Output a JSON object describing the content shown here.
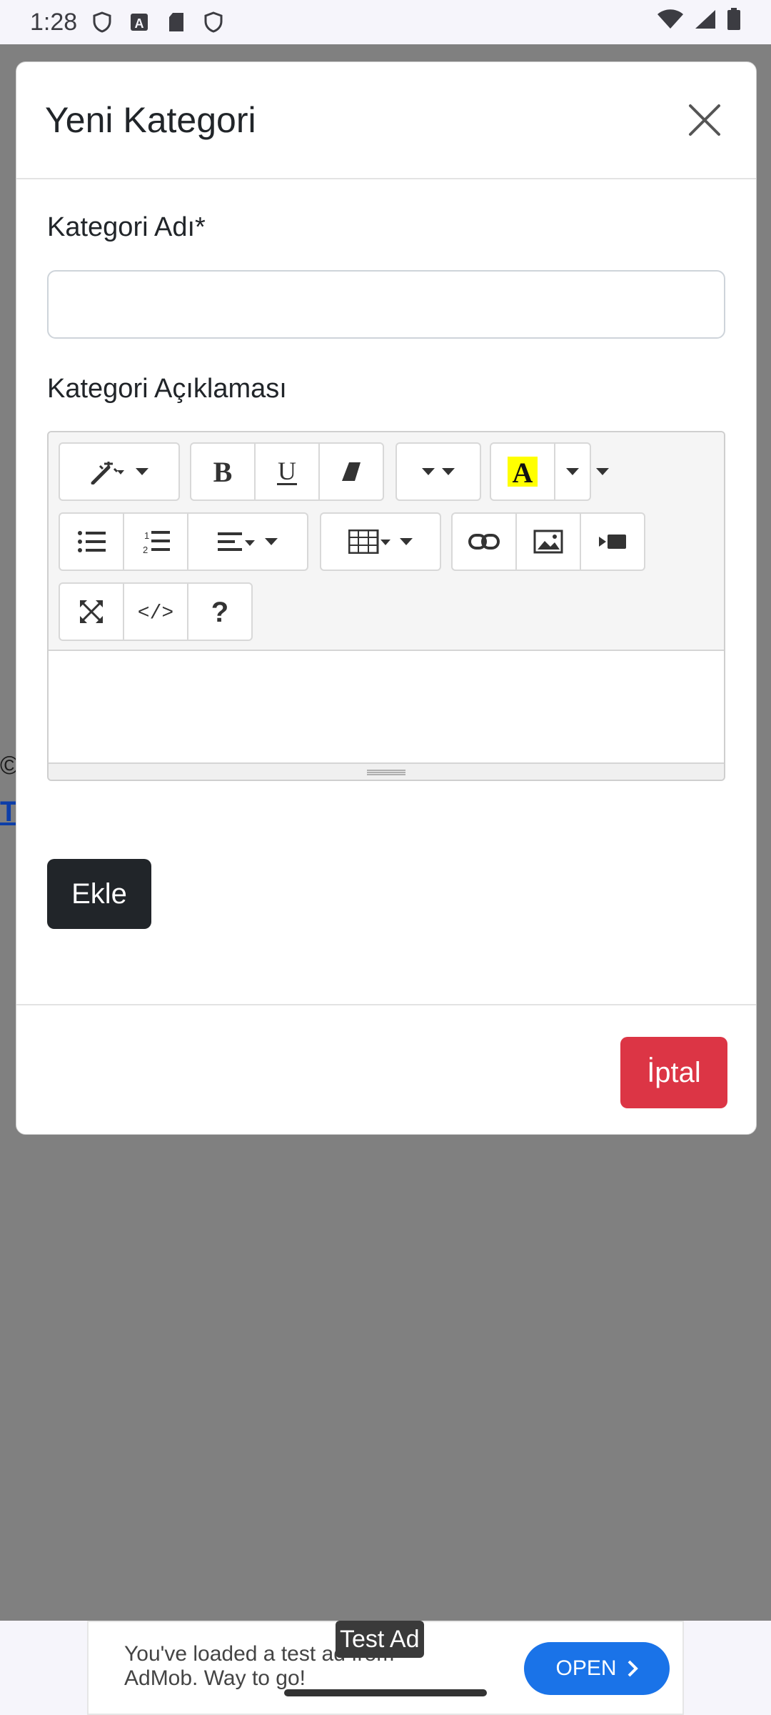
{
  "status_bar": {
    "time": "1:28"
  },
  "background": {
    "symbol": "©",
    "link_fragment": "T"
  },
  "modal": {
    "title": "Yeni Kategori",
    "name_label": "Kategori Adı*",
    "name_value": "",
    "desc_label": "Kategori Açıklaması",
    "add_button": "Ekle",
    "cancel_button": "İptal"
  },
  "editor": {
    "toolbar_icons": [
      "magic-style-icon",
      "bold-icon",
      "underline-icon",
      "eraser-icon",
      "font-size-icon",
      "text-color-icon",
      "unordered-list-icon",
      "ordered-list-icon",
      "align-icon",
      "table-icon",
      "link-icon",
      "image-icon",
      "video-icon",
      "fullscreen-icon",
      "code-view-icon",
      "help-icon"
    ],
    "highlight_color": "#ffff00"
  },
  "ad": {
    "badge": "Test Ad",
    "text_line1": "You've loaded a test ad from",
    "text_line2": "AdMob. Way to go!",
    "open_button": "OPEN"
  },
  "colors": {
    "primary_dark": "#212529",
    "danger": "#dc3545",
    "ad_blue": "#1a73e8",
    "overlay": "#808080"
  }
}
